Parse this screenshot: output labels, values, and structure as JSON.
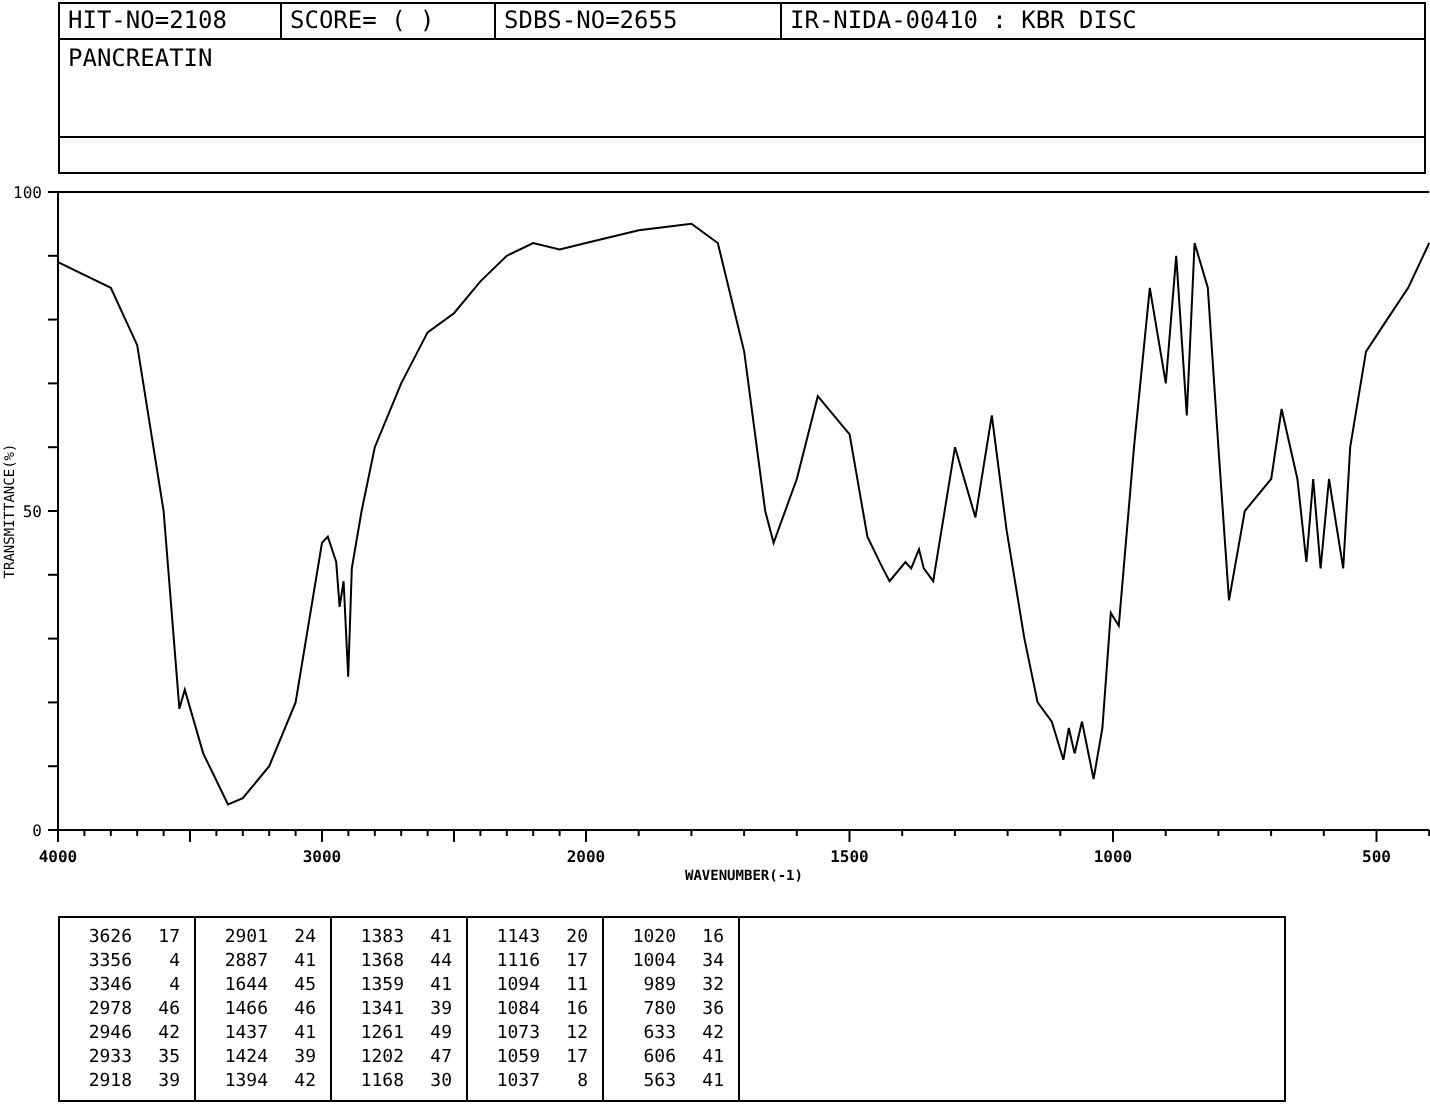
{
  "header": {
    "cells": [
      "HIT-NO=2108",
      "SCORE=  (   )",
      "SDBS-NO=2655",
      "IR-NIDA-00410 : KBR DISC"
    ],
    "compound": "PANCREATIN"
  },
  "spectrum": {
    "segments": [
      {
        "chart_data": {
          "type": "line",
          "ylabel": "TRANSMITTANCE(%)",
          "x": [
            4000,
            3800,
            3700,
            3600,
            3540,
            3520,
            3450,
            3356,
            3300,
            3200,
            3100,
            3000,
            2978,
            2946,
            2933,
            2918,
            2901,
            2887,
            2850,
            2800,
            2700,
            2600,
            2500,
            2400,
            2300,
            2200,
            2100,
            2000
          ],
          "series": [
            {
              "color": "#000000",
              "values": [
                89,
                85,
                76,
                50,
                19,
                22,
                12,
                4,
                5,
                10,
                20,
                45,
                46,
                42,
                35,
                39,
                24,
                41,
                50,
                60,
                70,
                78,
                81,
                86,
                90,
                92,
                91,
                92
              ]
            }
          ],
          "xlim": [
            4000,
            2000
          ],
          "ylim": [
            0,
            100
          ],
          "xticks": [
            4000,
            3000,
            2000
          ],
          "yticks": [
            0,
            50,
            100
          ]
        }
      },
      {
        "chart_data": {
          "type": "line",
          "xlabel": "WAVENUMBER(-1)",
          "x": [
            2000,
            1900,
            1800,
            1750,
            1700,
            1660,
            1644,
            1600,
            1560,
            1500,
            1466,
            1437,
            1424,
            1394,
            1383,
            1368,
            1359,
            1341,
            1300,
            1261,
            1230,
            1202,
            1168,
            1143,
            1116,
            1094,
            1084,
            1073,
            1059,
            1037,
            1020,
            1004,
            989,
            960,
            930,
            900,
            880,
            860,
            845,
            820,
            800,
            780,
            750,
            700,
            680,
            650,
            633,
            620,
            606,
            590,
            563,
            550,
            520,
            480,
            440,
            400
          ],
          "series": [
            {
              "color": "#000000",
              "values": [
                92,
                94,
                95,
                92,
                75,
                50,
                45,
                55,
                68,
                62,
                46,
                41,
                39,
                42,
                41,
                44,
                41,
                39,
                60,
                49,
                65,
                47,
                30,
                20,
                17,
                11,
                16,
                12,
                17,
                8,
                16,
                34,
                32,
                60,
                85,
                70,
                90,
                65,
                92,
                85,
                60,
                36,
                50,
                55,
                66,
                55,
                42,
                55,
                41,
                55,
                41,
                60,
                75,
                80,
                85,
                92
              ]
            }
          ],
          "xlim": [
            2000,
            400
          ],
          "ylim": [
            0,
            100
          ],
          "xticks": [
            1500,
            1000,
            500
          ]
        }
      }
    ]
  },
  "peak_table": {
    "columns": [
      [
        {
          "wavenumber": "3626",
          "value": "17"
        },
        {
          "wavenumber": "3356",
          "value": "4"
        },
        {
          "wavenumber": "3346",
          "value": "4"
        },
        {
          "wavenumber": "2978",
          "value": "46"
        },
        {
          "wavenumber": "2946",
          "value": "42"
        },
        {
          "wavenumber": "2933",
          "value": "35"
        },
        {
          "wavenumber": "2918",
          "value": "39"
        }
      ],
      [
        {
          "wavenumber": "2901",
          "value": "24"
        },
        {
          "wavenumber": "2887",
          "value": "41"
        },
        {
          "wavenumber": "1644",
          "value": "45"
        },
        {
          "wavenumber": "1466",
          "value": "46"
        },
        {
          "wavenumber": "1437",
          "value": "41"
        },
        {
          "wavenumber": "1424",
          "value": "39"
        },
        {
          "wavenumber": "1394",
          "value": "42"
        }
      ],
      [
        {
          "wavenumber": "1383",
          "value": "41"
        },
        {
          "wavenumber": "1368",
          "value": "44"
        },
        {
          "wavenumber": "1359",
          "value": "41"
        },
        {
          "wavenumber": "1341",
          "value": "39"
        },
        {
          "wavenumber": "1261",
          "value": "49"
        },
        {
          "wavenumber": "1202",
          "value": "47"
        },
        {
          "wavenumber": "1168",
          "value": "30"
        }
      ],
      [
        {
          "wavenumber": "1143",
          "value": "20"
        },
        {
          "wavenumber": "1116",
          "value": "17"
        },
        {
          "wavenumber": "1094",
          "value": "11"
        },
        {
          "wavenumber": "1084",
          "value": "16"
        },
        {
          "wavenumber": "1073",
          "value": "12"
        },
        {
          "wavenumber": "1059",
          "value": "17"
        },
        {
          "wavenumber": "1037",
          "value": "8"
        }
      ],
      [
        {
          "wavenumber": "1020",
          "value": "16"
        },
        {
          "wavenumber": "1004",
          "value": "34"
        },
        {
          "wavenumber": "989",
          "value": "32"
        },
        {
          "wavenumber": "780",
          "value": "36"
        },
        {
          "wavenumber": "633",
          "value": "42"
        },
        {
          "wavenumber": "606",
          "value": "41"
        },
        {
          "wavenumber": "563",
          "value": "41"
        }
      ]
    ]
  }
}
